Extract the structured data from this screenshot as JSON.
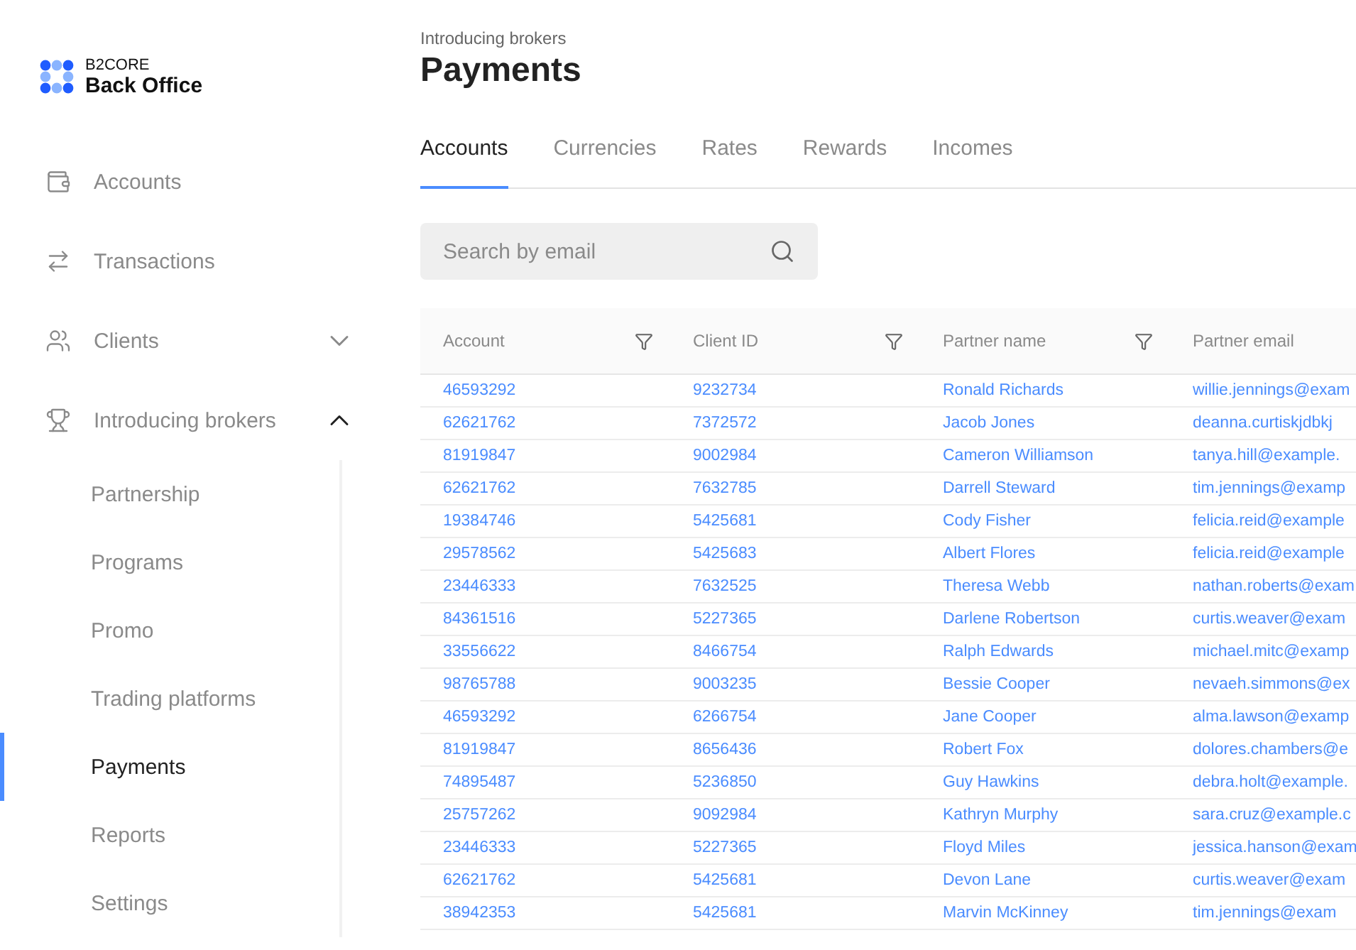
{
  "sidebar": {
    "logo": {
      "overline": "B2CORE",
      "title": "Back Office"
    },
    "items": [
      {
        "label": "Accounts",
        "selected": false
      },
      {
        "label": "Transactions",
        "selected": false
      },
      {
        "label": "Clients",
        "selected": false,
        "expanded": false
      },
      {
        "label": "Introducing brokers",
        "selected": false,
        "expanded": true,
        "children": [
          {
            "label": "Partnership",
            "selected": false
          },
          {
            "label": "Programs",
            "selected": false
          },
          {
            "label": "Promo",
            "selected": false
          },
          {
            "label": "Trading platforms",
            "selected": false
          },
          {
            "label": "Payments",
            "selected": true
          },
          {
            "label": "Reports",
            "selected": false
          },
          {
            "label": "Settings",
            "selected": false
          }
        ]
      }
    ]
  },
  "header": {
    "breadcrumb": "Introducing brokers",
    "title": "Payments"
  },
  "tabs": [
    {
      "label": "Accounts",
      "selected": true
    },
    {
      "label": "Currencies",
      "selected": false
    },
    {
      "label": "Rates",
      "selected": false
    },
    {
      "label": "Rewards",
      "selected": false
    },
    {
      "label": "Incomes",
      "selected": false
    }
  ],
  "search": {
    "placeholder": "Search by email"
  },
  "table": {
    "columns": [
      {
        "label": "Account",
        "filter": true
      },
      {
        "label": "Client ID",
        "filter": true
      },
      {
        "label": "Partner name",
        "filter": true
      },
      {
        "label": "Partner email",
        "filter": false
      }
    ],
    "rows": [
      [
        "46593292",
        "9232734",
        "Ronald Richards",
        "willie.jennings@exam"
      ],
      [
        "62621762",
        "7372572",
        "Jacob Jones",
        "deanna.curtiskjdbkj"
      ],
      [
        "81919847",
        "9002984",
        "Cameron Williamson",
        "tanya.hill@example."
      ],
      [
        "62621762",
        "7632785",
        "Darrell Steward",
        "tim.jennings@examp"
      ],
      [
        "19384746",
        "5425681",
        "Cody Fisher",
        "felicia.reid@example"
      ],
      [
        "29578562",
        "5425683",
        "Albert Flores",
        "felicia.reid@example"
      ],
      [
        "23446333",
        "7632525",
        "Theresa Webb",
        "nathan.roberts@exam"
      ],
      [
        "84361516",
        "5227365",
        "Darlene Robertson",
        "curtis.weaver@exam"
      ],
      [
        "33556622",
        "8466754",
        "Ralph Edwards",
        "michael.mitc@examp"
      ],
      [
        "98765788",
        "9003235",
        "Bessie Cooper",
        "nevaeh.simmons@ex"
      ],
      [
        "46593292",
        "6266754",
        "Jane Cooper",
        "alma.lawson@examp"
      ],
      [
        "81919847",
        "8656436",
        "Robert Fox",
        "dolores.chambers@e"
      ],
      [
        "74895487",
        "5236850",
        "Guy Hawkins",
        "debra.holt@example."
      ],
      [
        "25757262",
        "9092984",
        "Kathryn Murphy",
        "sara.cruz@example.c"
      ],
      [
        "23446333",
        "5227365",
        "Floyd Miles",
        "jessica.hanson@exam"
      ],
      [
        "62621762",
        "5425681",
        "Devon Lane",
        "curtis.weaver@exam"
      ],
      [
        "38942353",
        "5425681",
        "Marvin McKinney",
        "tim.jennings@exam"
      ]
    ]
  }
}
